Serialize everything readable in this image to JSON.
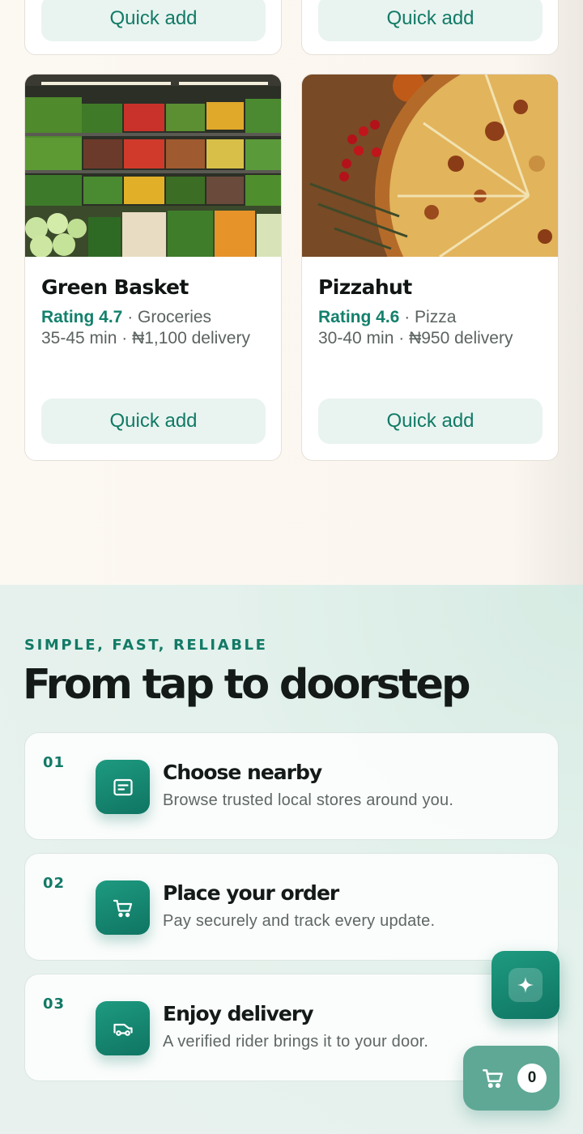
{
  "store_cards_top": [
    {
      "quick_add_label": "Quick add"
    },
    {
      "quick_add_label": "Quick add"
    }
  ],
  "store_cards": [
    {
      "name": "Green Basket",
      "rating": "Rating 4.7",
      "category": "Groceries",
      "delivery_time": "35-45 min",
      "delivery_fee": "₦1,100 delivery",
      "quick_add_label": "Quick add",
      "image": "grocery-shelves"
    },
    {
      "name": "Pizzahut",
      "rating": "Rating 4.6",
      "category": "Pizza",
      "delivery_time": "30-40 min",
      "delivery_fee": "₦950 delivery",
      "quick_add_label": "Quick add",
      "image": "pizza"
    }
  ],
  "how_it_works": {
    "eyebrow": "SIMPLE, FAST, RELIABLE",
    "heading": "From tap to doorstep",
    "steps": [
      {
        "number": "01",
        "icon": "store-list-icon",
        "title": "Choose nearby",
        "description": "Browse trusted local stores around you."
      },
      {
        "number": "02",
        "icon": "cart-icon",
        "title": "Place your order",
        "description": "Pay securely and track every update."
      },
      {
        "number": "03",
        "icon": "delivery-truck-icon",
        "title": "Enjoy delivery",
        "description": "A verified rider brings it to your door."
      }
    ]
  },
  "floating": {
    "assistant_icon": "sparkle-icon",
    "cart_icon": "cart-icon",
    "cart_count": "0"
  },
  "colors": {
    "accent": "#127a66",
    "accent_soft": "#e9f4f0",
    "cart_fab": "#5fa896"
  }
}
